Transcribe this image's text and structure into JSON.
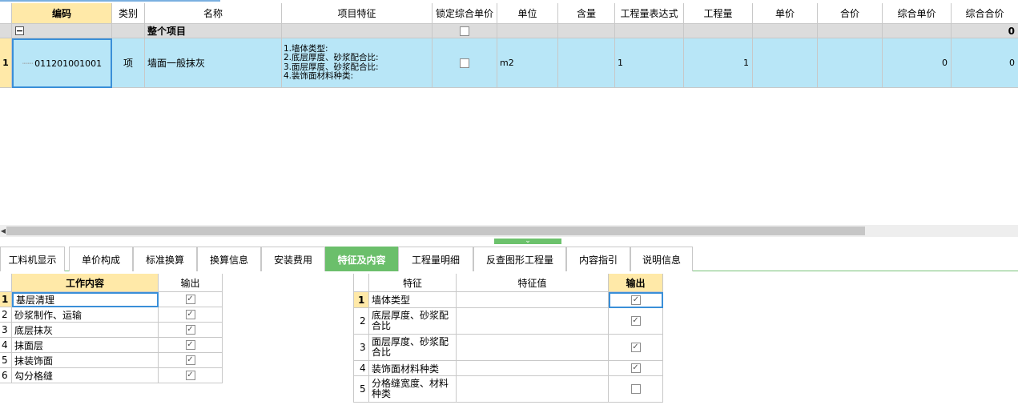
{
  "grid": {
    "headers": [
      "编码",
      "类别",
      "名称",
      "项目特征",
      "锁定综合单价",
      "单位",
      "含量",
      "工程量表达式",
      "工程量",
      "单价",
      "合价",
      "综合单价",
      "综合合价"
    ],
    "group_row": {
      "label": "整个项目",
      "total": "0"
    },
    "rows": [
      {
        "index": "1",
        "code": "011201001001",
        "category": "项",
        "name": "墙面一般抹灰",
        "features": "1.墙体类型:\n2.底层厚度、砂浆配合比:\n3.面层厚度、砂浆配合比:\n4.装饰面材料种类:",
        "locked": false,
        "unit": "m2",
        "content": "",
        "qty_expression": "1",
        "quantity": "1",
        "unit_price": "",
        "total_price": "",
        "composite_unit_price": "0",
        "composite_total": "0"
      }
    ]
  },
  "tabs": [
    "工料机显示",
    "单价构成",
    "标准换算",
    "换算信息",
    "安装费用",
    "特征及内容",
    "工程量明细",
    "反查图形工程量",
    "内容指引",
    "说明信息"
  ],
  "active_tab": "特征及内容",
  "work_table": {
    "headers": [
      "工作内容",
      "输出"
    ],
    "rows": [
      {
        "index": "1",
        "content": "基层清理",
        "output": true
      },
      {
        "index": "2",
        "content": "砂浆制作、运输",
        "output": true
      },
      {
        "index": "3",
        "content": "底层抹灰",
        "output": true
      },
      {
        "index": "4",
        "content": "抹面层",
        "output": true
      },
      {
        "index": "5",
        "content": "抹装饰面",
        "output": true
      },
      {
        "index": "6",
        "content": "勾分格缝",
        "output": true
      }
    ]
  },
  "feature_table": {
    "headers": [
      "特征",
      "特征值",
      "输出"
    ],
    "rows": [
      {
        "index": "1",
        "feature": "墙体类型",
        "value": "",
        "output": true
      },
      {
        "index": "2",
        "feature": "底层厚度、砂浆配合比",
        "value": "",
        "output": true
      },
      {
        "index": "3",
        "feature": "面层厚度、砂浆配合比",
        "value": "",
        "output": true
      },
      {
        "index": "4",
        "feature": "装饰面材料种类",
        "value": "",
        "output": true
      },
      {
        "index": "5",
        "feature": "分格缝宽度、材料种类",
        "value": "",
        "output": false
      }
    ]
  },
  "colors": {
    "header_key": "#ffe9a8",
    "selected_row": "#b8e6f7",
    "active_tab": "#6bbf6b",
    "group_row": "#dcdcdc"
  }
}
